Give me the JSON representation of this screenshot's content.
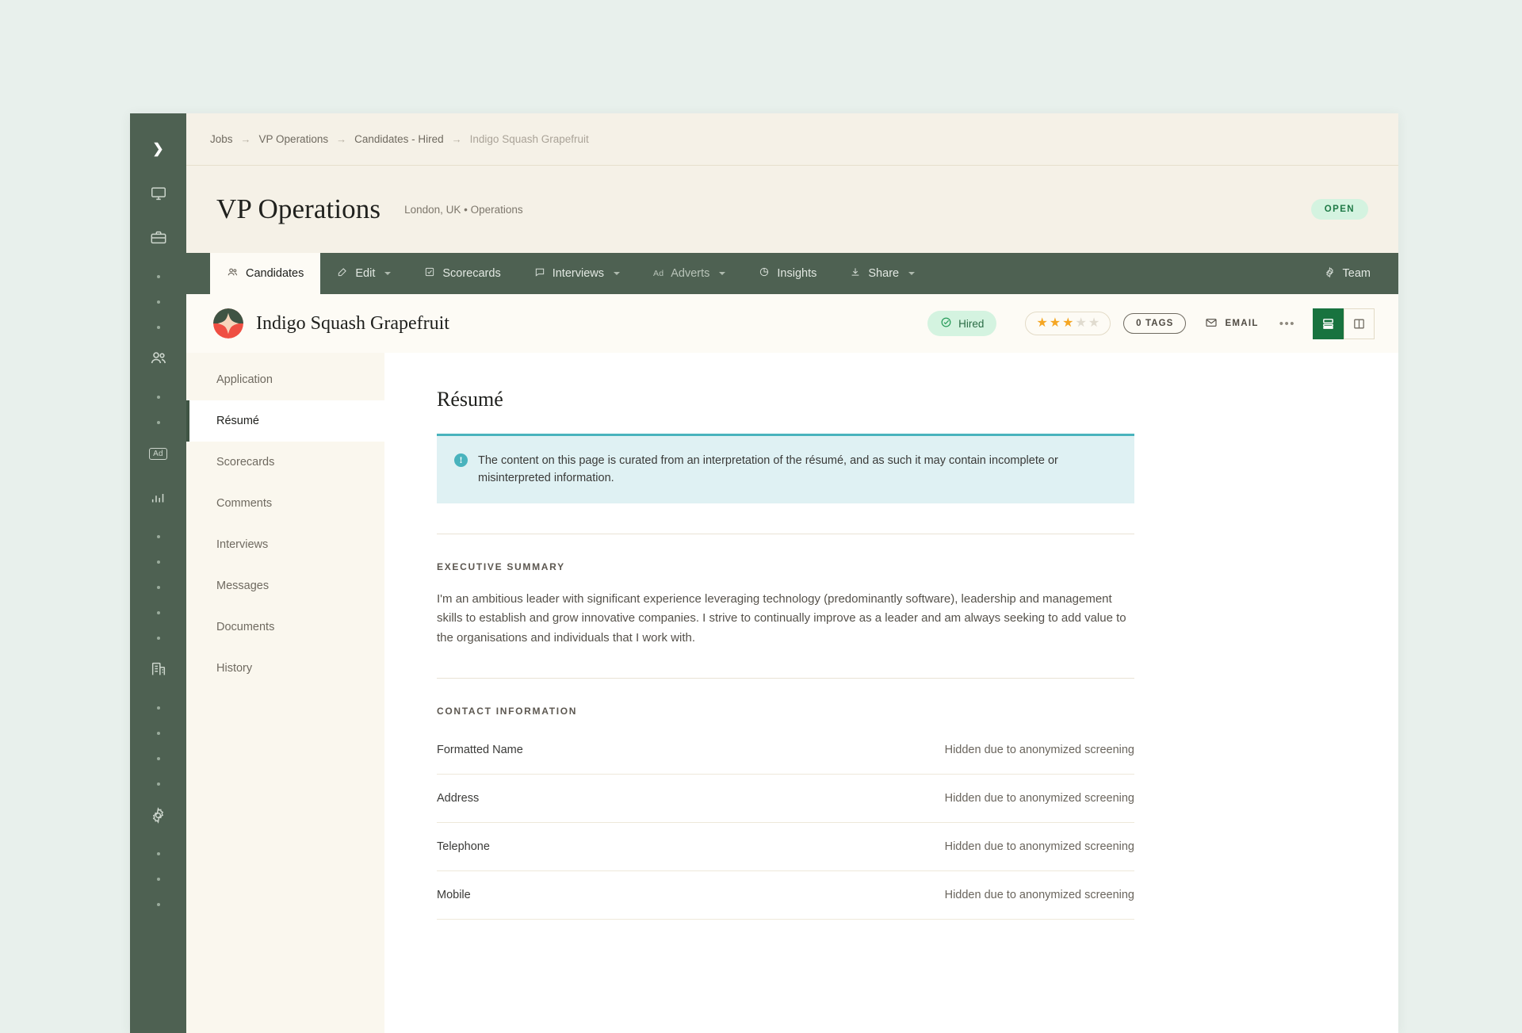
{
  "breadcrumb": [
    {
      "label": "Jobs",
      "current": false
    },
    {
      "label": "VP Operations",
      "current": false
    },
    {
      "label": "Candidates - Hired",
      "current": false
    },
    {
      "label": "Indigo Squash Grapefruit",
      "current": true
    }
  ],
  "breadcrumb_separator": "→",
  "header": {
    "title": "VP Operations",
    "meta": "London, UK  •  Operations",
    "status_badge": "OPEN"
  },
  "tabs": [
    {
      "label": "Candidates",
      "icon": "people-icon",
      "active": true,
      "caret": false
    },
    {
      "label": "Edit",
      "icon": "edit-icon",
      "active": false,
      "caret": true
    },
    {
      "label": "Scorecards",
      "icon": "checkbox-icon",
      "active": false,
      "caret": false
    },
    {
      "label": "Interviews",
      "icon": "comment-icon",
      "active": false,
      "caret": true
    },
    {
      "label": "Adverts",
      "icon": "ad-icon",
      "active": false,
      "caret": true
    },
    {
      "label": "Insights",
      "icon": "pie-chart-icon",
      "active": false,
      "caret": false
    },
    {
      "label": "Share",
      "icon": "download-icon",
      "active": false,
      "caret": true
    }
  ],
  "tab_right": {
    "label": "Team",
    "icon": "gear-icon"
  },
  "candidate": {
    "name": "Indigo Squash Grapefruit",
    "status": "Hired",
    "rating": 3,
    "rating_max": 5,
    "tags_label": "0 TAGS",
    "email_label": "EMAIL",
    "more_label": "•••"
  },
  "subnav": [
    {
      "label": "Application",
      "active": false
    },
    {
      "label": "Résumé",
      "active": true
    },
    {
      "label": "Scorecards",
      "active": false
    },
    {
      "label": "Comments",
      "active": false
    },
    {
      "label": "Interviews",
      "active": false
    },
    {
      "label": "Messages",
      "active": false
    },
    {
      "label": "Documents",
      "active": false
    },
    {
      "label": "History",
      "active": false
    }
  ],
  "resume": {
    "title": "Résumé",
    "notice": "The content on this page is curated from an interpretation of the résumé, and as such it may contain incomplete or misinterpreted information.",
    "notice_icon": "!",
    "executive_summary_heading": "EXECUTIVE SUMMARY",
    "executive_summary": "I'm an ambitious leader with significant experience leveraging technology (predominantly software), leadership and management skills to establish and grow innovative companies. I strive to continually improve as a leader and am always seeking to add value to the organisations and individuals that I work with.",
    "contact_heading": "CONTACT INFORMATION",
    "contact_rows": [
      {
        "label": "Formatted Name",
        "value": "Hidden due to anonymized screening"
      },
      {
        "label": "Address",
        "value": "Hidden due to anonymized screening"
      },
      {
        "label": "Telephone",
        "value": "Hidden due to anonymized screening"
      },
      {
        "label": "Mobile",
        "value": "Hidden due to anonymized screening"
      }
    ]
  },
  "colors": {
    "page_bg": "#e8f0ec",
    "rail_green": "#4e6152",
    "cream": "#f5f1e7",
    "accent_green": "#18733f",
    "mint": "#d4f3e0",
    "notice_teal": "#49b3bd",
    "star_gold": "#f5a623"
  }
}
